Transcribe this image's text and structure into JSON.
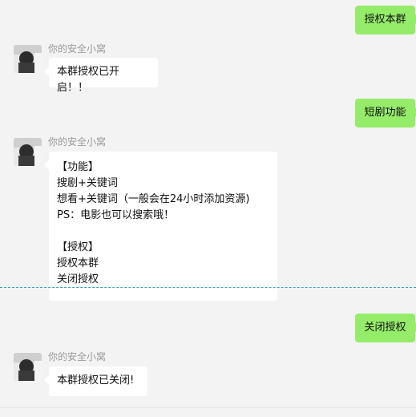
{
  "sender_name": "你的安全小窝",
  "messages": [
    {
      "id": "m1",
      "side": "me",
      "text": "授权本群"
    },
    {
      "id": "m2",
      "side": "other",
      "text": "本群授权已开启！！"
    },
    {
      "id": "m3",
      "side": "me",
      "text": "短剧功能"
    },
    {
      "id": "m4",
      "side": "other",
      "lines": [
        "【功能】",
        "搜剧+关键词",
        "想看+关键词（一般会在24小时添加资源)",
        "PS：电影也可以搜索哦！",
        "",
        "【授权】",
        "授权本群",
        "关闭授权"
      ]
    },
    {
      "id": "m5",
      "side": "me",
      "text": "关闭授权"
    },
    {
      "id": "m6",
      "side": "other",
      "text": "本群授权已关闭!"
    }
  ],
  "colors": {
    "background": "#f3f3f3",
    "my_bubble": "#95ec69",
    "other_bubble": "#ffffff",
    "sender_text": "#9a9a9a",
    "divider": "#3aa0c8"
  },
  "icons": {
    "avatar": "user-avatar-photo"
  }
}
